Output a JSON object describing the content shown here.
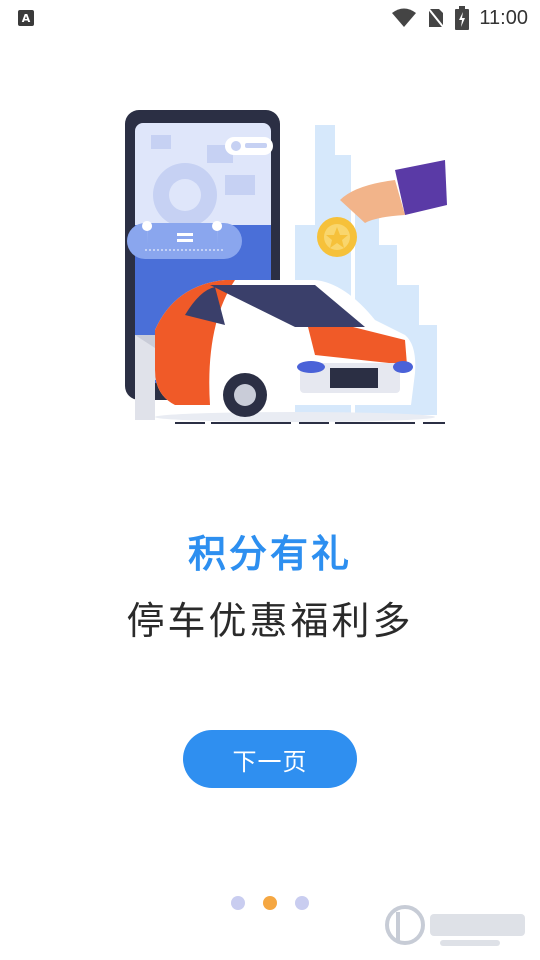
{
  "status_bar": {
    "app_icon_letter": "A",
    "time": "11:00",
    "icons": [
      "wifi-icon",
      "no-sim-icon",
      "battery-charging-icon"
    ]
  },
  "onboarding": {
    "title": "积分有礼",
    "subtitle": "停车优惠福利多",
    "next_button_label": "下一页",
    "page_indicator": {
      "total": 3,
      "active_index": 1
    }
  },
  "colors": {
    "accent_blue": "#2f8ff0",
    "dot_active": "#f5a742",
    "dot_inactive": "#c9cdf0",
    "car_orange": "#f05a28"
  }
}
